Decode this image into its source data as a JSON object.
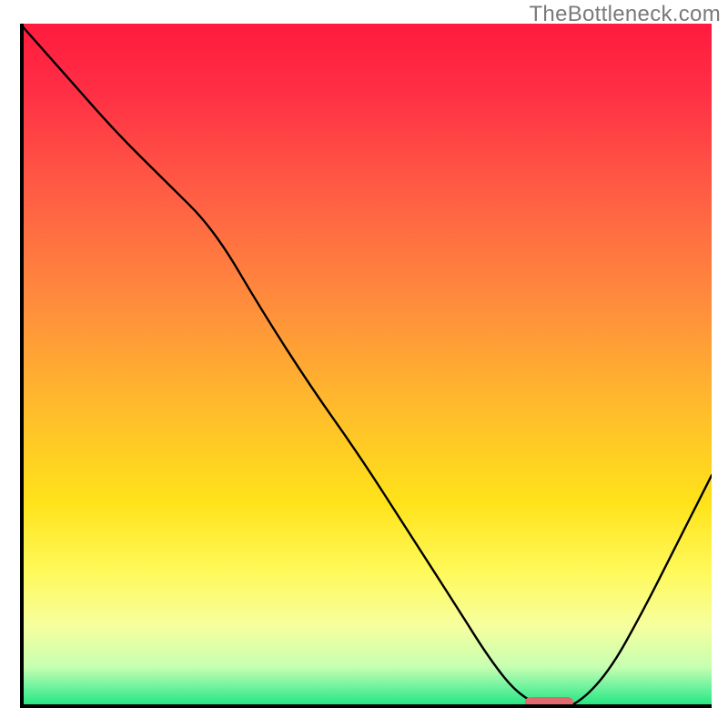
{
  "watermark": "TheBottleneck.com",
  "chart_data": {
    "type": "line",
    "title": "",
    "xlabel": "",
    "ylabel": "",
    "xlim": [
      0,
      100
    ],
    "ylim": [
      0,
      100
    ],
    "grid": false,
    "series": [
      {
        "name": "bottleneck-curve",
        "x": [
          0,
          7,
          14,
          21,
          28,
          35,
          42,
          49,
          56,
          63,
          68,
          72,
          76,
          80,
          85,
          90,
          95,
          100
        ],
        "values": [
          100,
          92,
          84,
          77,
          70,
          58,
          47,
          37,
          26,
          15,
          7,
          2,
          0,
          0,
          5,
          14,
          24,
          34
        ]
      }
    ],
    "marker": {
      "name": "optimal-segment",
      "x_start": 73,
      "x_end": 80,
      "y": 0.8,
      "color": "#e06a6e"
    },
    "background_gradient": {
      "top": "#ff1b3e",
      "mid": "#ffe31a",
      "bottom": "#18e47c"
    }
  }
}
